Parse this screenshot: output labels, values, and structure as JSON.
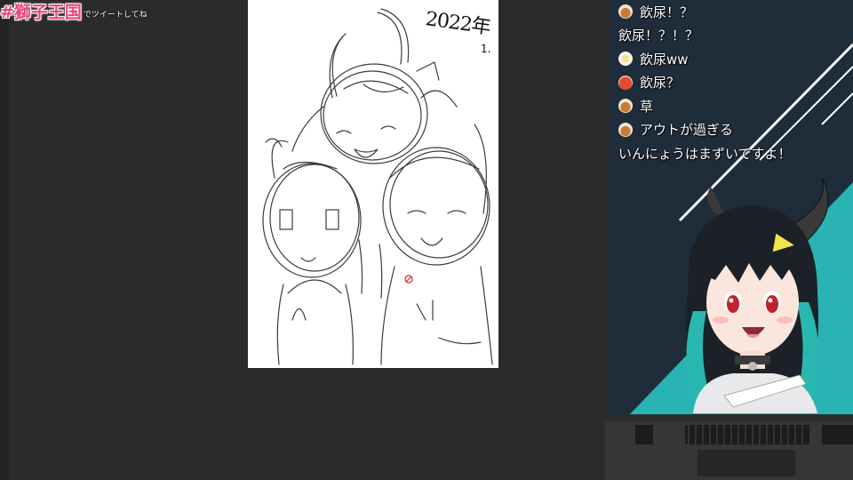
{
  "overlay": {
    "hashtag": "#獅子王国",
    "hashtag_suffix": "でツイートしてね"
  },
  "canvas": {
    "date_text": "2022年",
    "date_sub": "1."
  },
  "chat": {
    "messages": [
      {
        "icon": "bowl-icon",
        "text": "飲尿！？"
      },
      {
        "icon": "",
        "text": "飲尿！？！？"
      },
      {
        "icon": "egg-icon",
        "text": "飲尿ww"
      },
      {
        "icon": "tomato-icon",
        "text": "飲尿？"
      },
      {
        "icon": "bowl-icon",
        "text": "草"
      },
      {
        "icon": "bowl-icon",
        "text": "アウトが過ぎる"
      },
      {
        "icon": "",
        "text": "いんにょうはまずいですよ！"
      }
    ]
  },
  "colors": {
    "workspace": "#2b2b2b",
    "side_panel": "#1f2c3a",
    "accent_teal": "#2ab3b3",
    "hashtag_pink": "#e8457a"
  }
}
